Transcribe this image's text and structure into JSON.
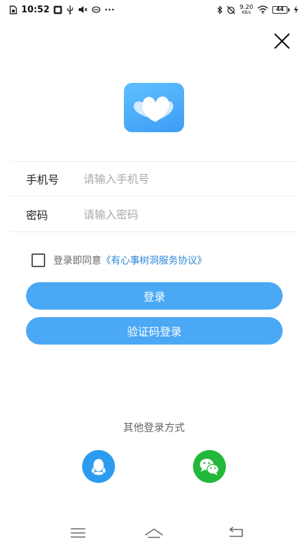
{
  "status_bar": {
    "time": "10:52",
    "net_speed_value": "9.20",
    "net_speed_unit": "KB/s",
    "battery": "44"
  },
  "icons": {
    "close": "close-icon",
    "logo": "app-logo-hearts",
    "qq": "qq-penguin-icon",
    "wechat": "wechat-icon"
  },
  "form": {
    "phone_label": "手机号",
    "phone_placeholder": "请输入手机号",
    "phone_value": "",
    "password_label": "密码",
    "password_placeholder": "请输入密码",
    "password_value": ""
  },
  "agreement": {
    "prefix": "登录即同意",
    "link": "《有心事树洞服务协议》",
    "checked": false
  },
  "buttons": {
    "login": "登录",
    "code_login": "验证码登录"
  },
  "other_login": {
    "title": "其他登录方式"
  },
  "colors": {
    "primary": "#4aa8f5",
    "link": "#2f86d9",
    "qq": "#2d9cf0",
    "wechat": "#22b83a"
  }
}
